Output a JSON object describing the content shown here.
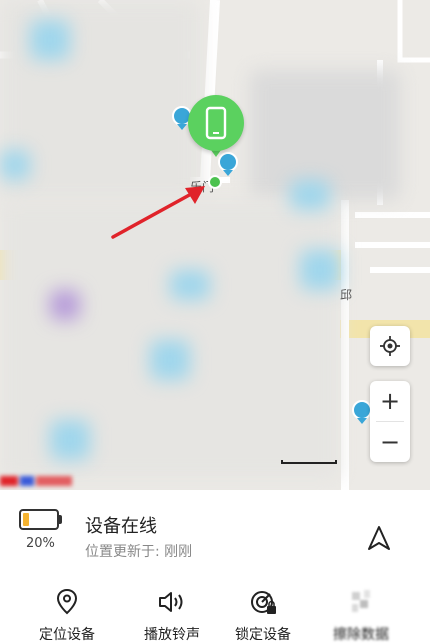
{
  "map": {
    "place_label": "乐门",
    "district_label": "邱",
    "colors": {
      "marker": "#5bd15f",
      "poi": "#3aa6d8",
      "arrow": "#e0232a",
      "road_yellow": "#f3e3a0"
    }
  },
  "controls": {
    "locate_icon": "crosshair-icon",
    "zoom_in_label": "+",
    "zoom_out_label": "−"
  },
  "device": {
    "battery_percent_text": "20%",
    "battery_level": 0.2,
    "status": "设备在线",
    "update_prefix": "位置更新于:",
    "update_time": "刚刚"
  },
  "actions": [
    {
      "label": "定位设备",
      "icon": "map-pin-icon"
    },
    {
      "label": "播放铃声",
      "icon": "speaker-icon"
    },
    {
      "label": "锁定设备",
      "icon": "lock-radar-icon"
    },
    {
      "label": "擦除数据",
      "icon": "erase-icon"
    }
  ]
}
